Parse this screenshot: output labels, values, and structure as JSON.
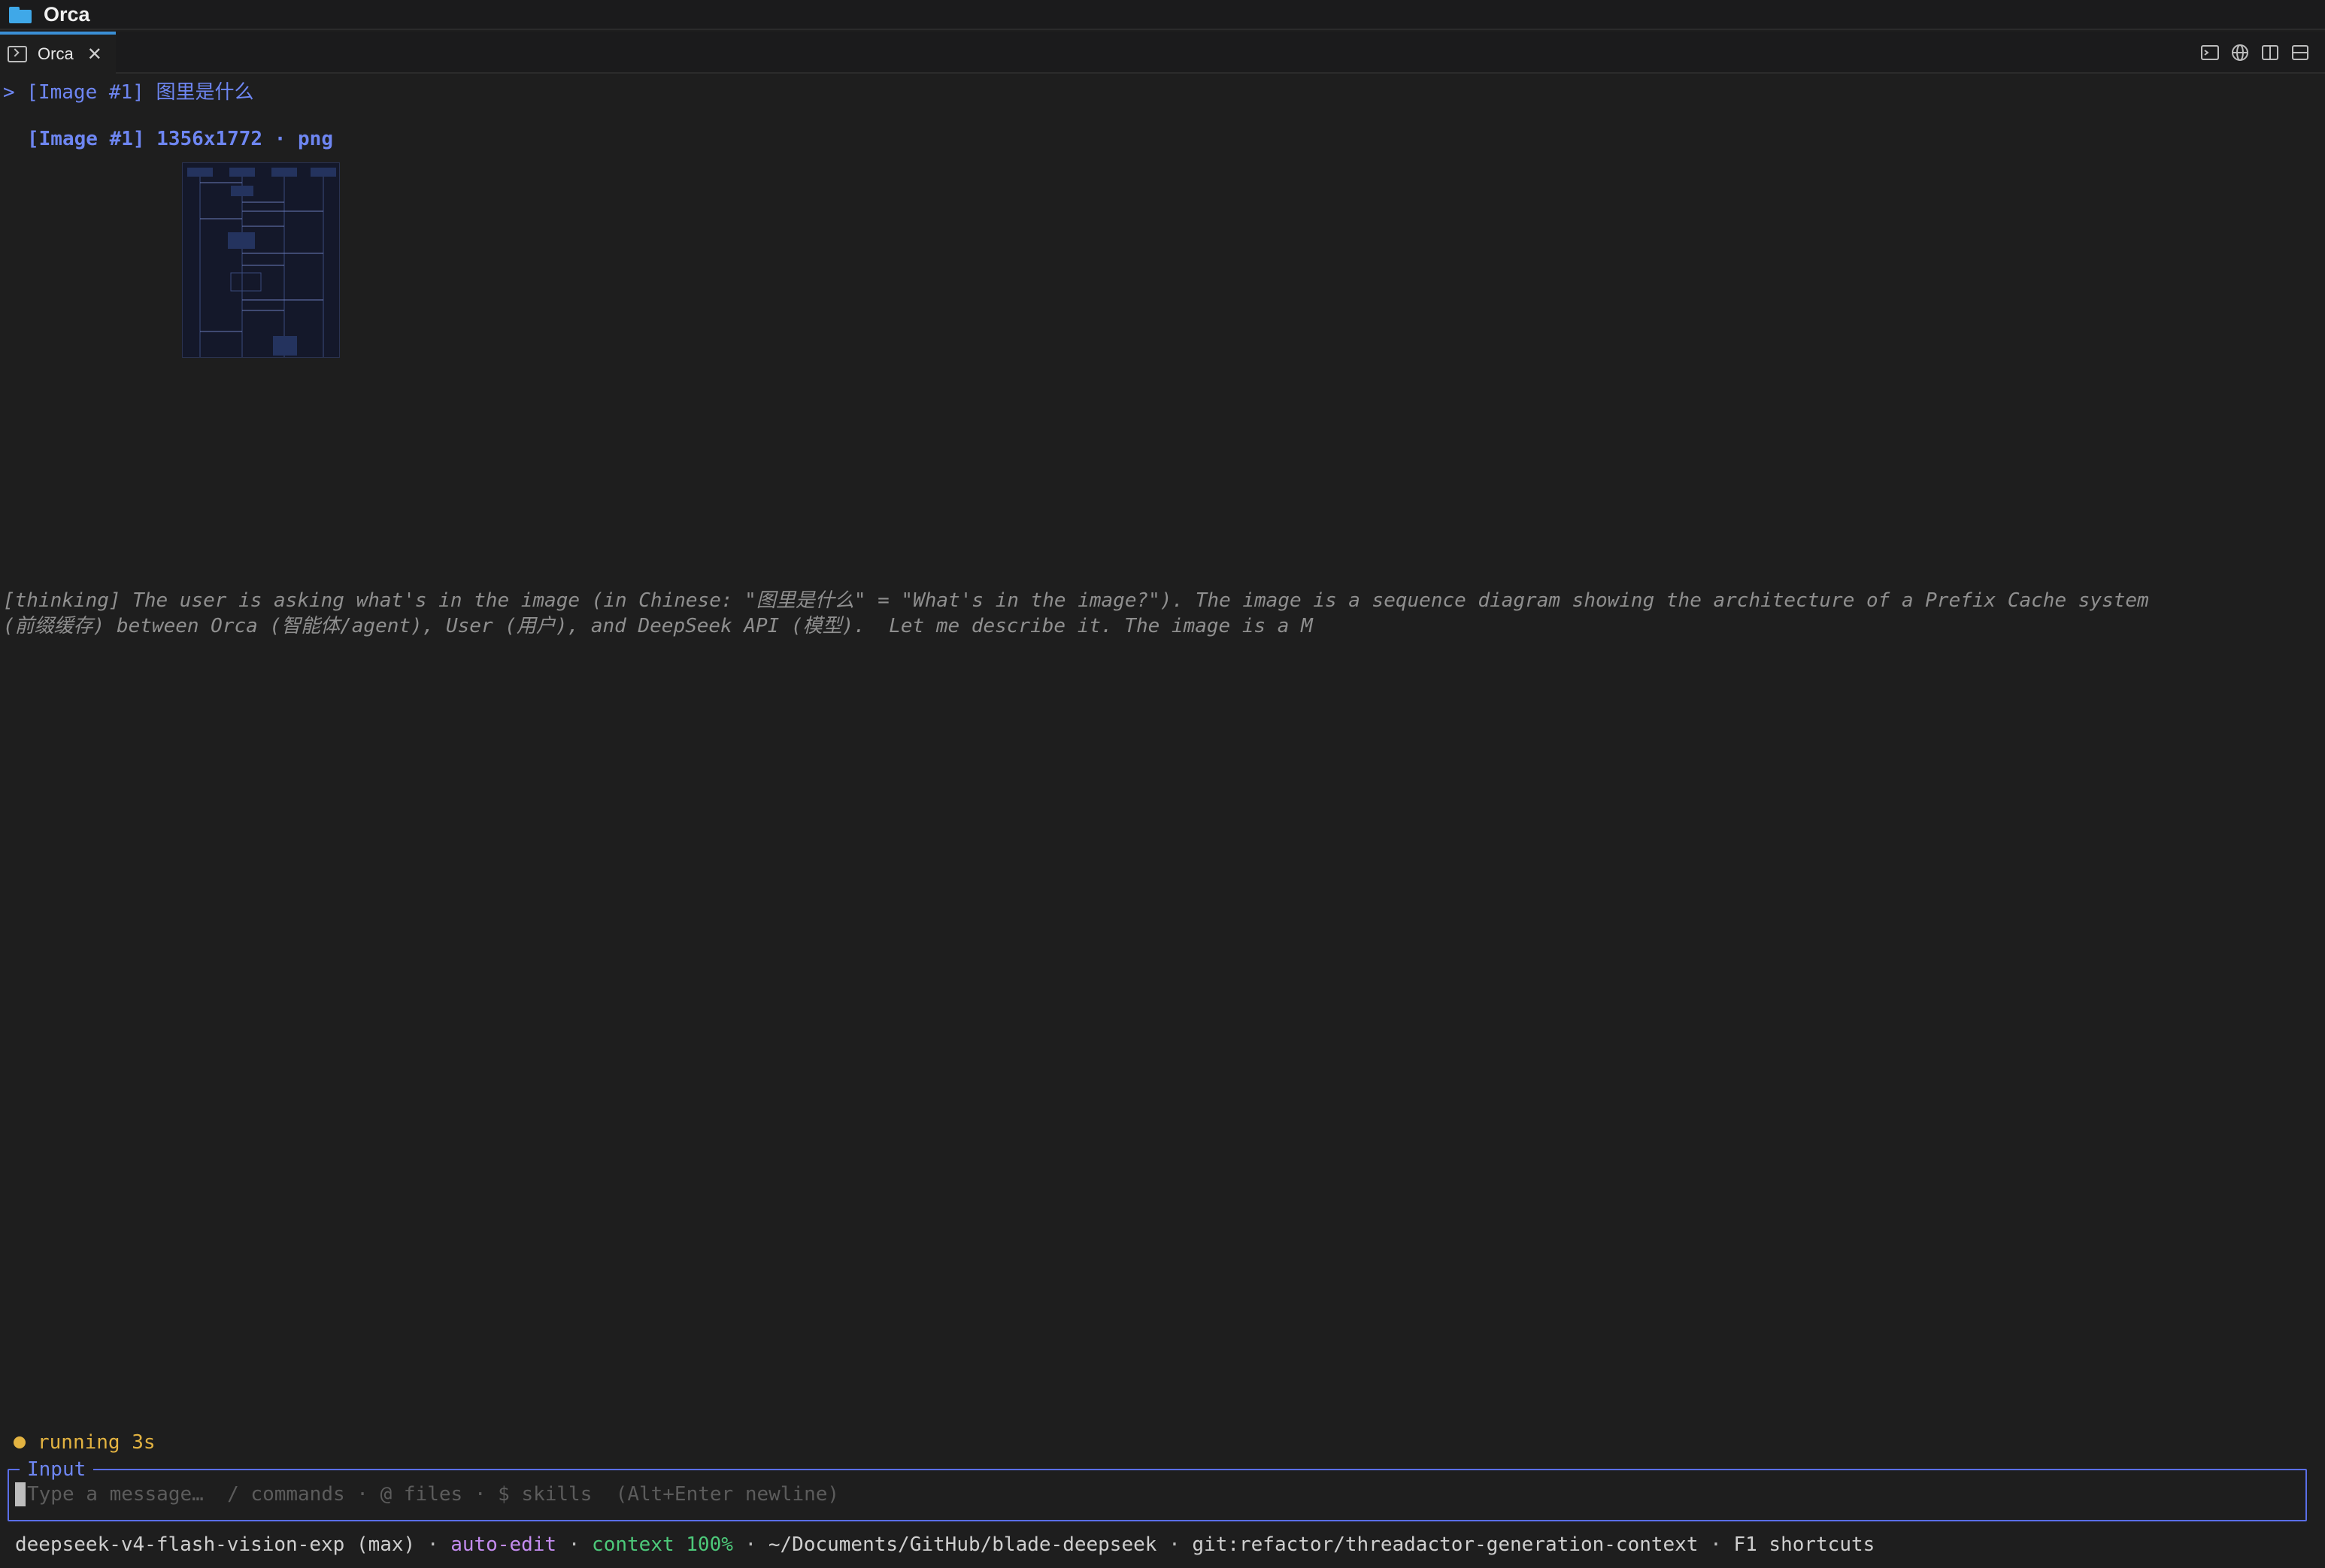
{
  "window": {
    "title": "Orca"
  },
  "tab": {
    "label": "Orca",
    "close": "✕"
  },
  "conversation": {
    "prompt": "> [Image #1] 图里是什么",
    "image_ref": "[Image #1]  1356x1772 · png",
    "thinking": "[thinking] The user is asking what's in the image (in Chinese: \"图里是什么\" = \"What's in the image?\"). The image is a sequence diagram showing the architecture of a Prefix Cache system\n(前缀缓存) between Orca (智能体/agent), User (用户), and DeepSeek API (模型).  Let me describe it. The image is a M"
  },
  "status": {
    "text": "running 3s",
    "color": "#e3b341"
  },
  "input": {
    "legend": "Input",
    "placeholder": "Type a message…  / commands · @ files · $ skills  (Alt+Enter newline)",
    "value": ""
  },
  "statusline": {
    "model": "deepseek-v4-flash-vision-exp (max)",
    "mode": "auto-edit",
    "context": "context 100%",
    "path": "~/Documents/GitHub/blade-deepseek",
    "git": "git:refactor/threadactor-generation-context",
    "help": "F1 shortcuts",
    "separator": " · "
  },
  "colors": {
    "accent": "#6e86f2",
    "mode": "#c48cf0",
    "context": "#4dc97a",
    "thinking": "#8f8f8f"
  },
  "icons": [
    "folder-icon",
    "terminal-icon",
    "close-icon",
    "new-terminal-icon",
    "globe-icon",
    "split-vertical-icon",
    "split-horizontal-icon"
  ]
}
